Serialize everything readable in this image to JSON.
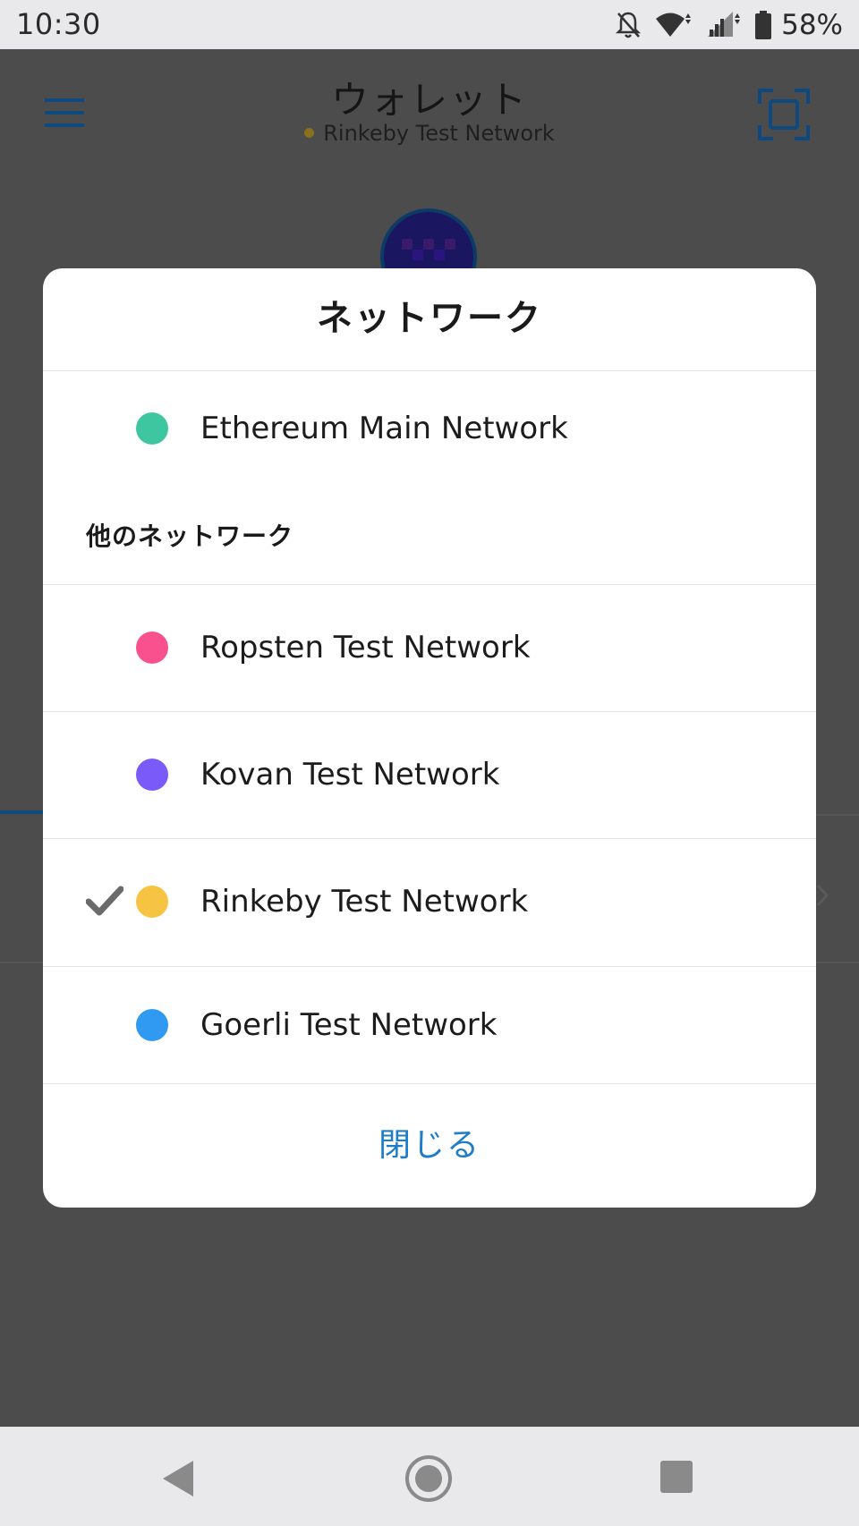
{
  "status_bar": {
    "time": "10:30",
    "battery_percent": "58%",
    "icons": [
      "notifications-off-icon",
      "wifi-icon",
      "signal-icon",
      "battery-icon"
    ]
  },
  "app_header": {
    "title": "ウォレット",
    "network": "Rinkeby Test Network",
    "menu_icon": "hamburger-menu-icon",
    "scan_icon": "qr-scan-icon"
  },
  "modal": {
    "title": "ネットワーク",
    "main_network": {
      "label": "Ethereum Main Network",
      "color": "#3ec6a0",
      "selected": false
    },
    "other_networks_label": "他のネットワーク",
    "other_networks": [
      {
        "label": "Ropsten Test Network",
        "color": "#f9518d",
        "selected": false
      },
      {
        "label": "Kovan Test Network",
        "color": "#7a5af8",
        "selected": false
      },
      {
        "label": "Rinkeby Test Network",
        "color": "#f6c343",
        "selected": true
      },
      {
        "label": "Goerli Test Network",
        "color": "#3099f2",
        "selected": false
      }
    ],
    "close_label": "閉じる"
  },
  "colors": {
    "accent": "#1e7cc8",
    "overlay": "#4c4c4c",
    "check": "#6b6b6b"
  },
  "nav_bar": {
    "icons": [
      "back-icon",
      "home-icon",
      "recent-apps-icon"
    ]
  }
}
